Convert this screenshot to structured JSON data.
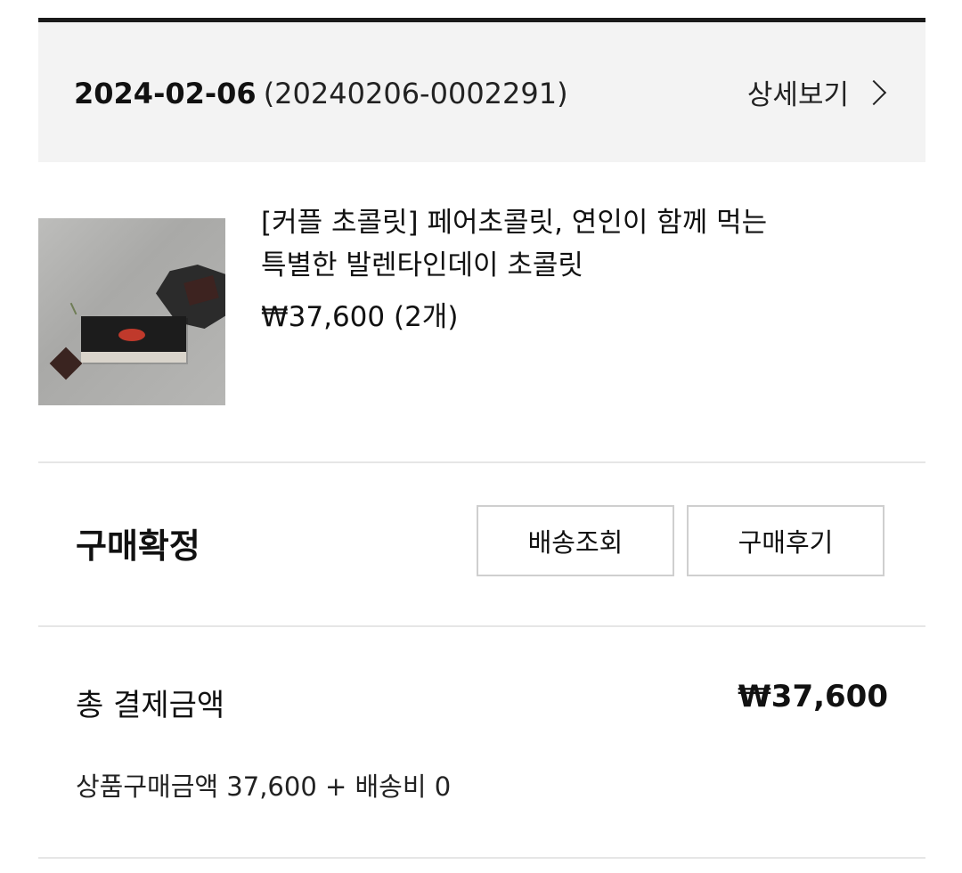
{
  "order": {
    "date": "2024-02-06",
    "number": "(20240206-0002291)",
    "detail_label": "상세보기"
  },
  "product": {
    "name_line1": "[커플 초콜릿] 페어초콜릿, 연인이 함께 먹는",
    "name_line2": "특별한 발렌타인데이 초콜릿",
    "price": "₩37,600 (2개)",
    "image_alt": "chocolate-box-product-photo"
  },
  "status": {
    "label": "구매확정",
    "track_button": "배송조회",
    "review_button": "구매후기"
  },
  "payment": {
    "total_label": "총 결제금액",
    "total_amount": "₩37,600",
    "breakdown": "상품구매금액 37,600 + 배송비 0"
  },
  "colors": {
    "header_bg": "#f3f3f3",
    "top_rule": "#1a1a1a",
    "divider": "#e6e6e6",
    "button_border": "#cfcfcf"
  }
}
